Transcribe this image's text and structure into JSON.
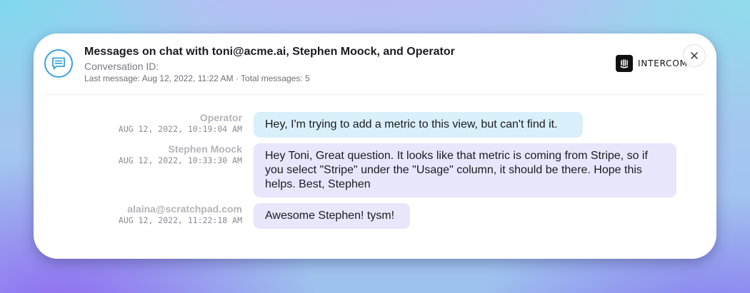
{
  "header": {
    "title": "Messages on chat with toni@acme.ai, Stephen Moock, and Operator",
    "conversation_id_label": "Conversation ID:",
    "meta": "Last message: Aug 12, 2022, 11:22 AM · Total messages: 5",
    "icon": "chat-bubble-icon"
  },
  "brand": {
    "name": "INTERCOM",
    "icon": "intercom-logo"
  },
  "close": {
    "label": "×",
    "icon": "close-icon"
  },
  "colors": {
    "accent": "#3aa3de",
    "bubble_operator": "#d9f0fb",
    "bubble_user": "#e8e6fb"
  },
  "messages": [
    {
      "sender": "Operator",
      "timestamp": "AUG 12, 2022, 10:19:04 AM",
      "text": "Hey, I'm trying to add a metric to this view, but can't find it."
    },
    {
      "sender": "Stephen Moock",
      "timestamp": "AUG 12, 2022, 10:33:30 AM",
      "text": "Hey Toni, Great question. It looks like that metric is coming from Stripe, so if you select \"Stripe\" under the \"Usage\" column, it should be there. Hope this helps. Best, Stephen"
    },
    {
      "sender": "alaina@scratchpad.com",
      "timestamp": "AUG 12, 2022, 11:22:18 AM",
      "text": "Awesome Stephen! tysm!"
    }
  ]
}
